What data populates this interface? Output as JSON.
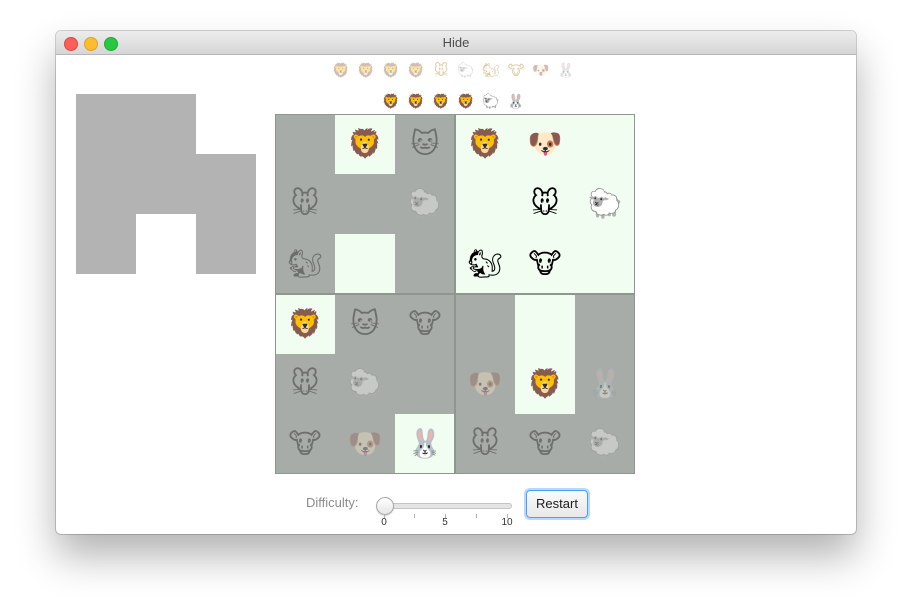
{
  "window": {
    "title": "Hide"
  },
  "colors": {
    "board_background": "#a8aca8",
    "revealed_cell": "#f1fdf0",
    "shape_block": "#b3b3b3",
    "focus_ring": "#4aa0f7"
  },
  "animal_icons": {
    "lion": "🦁",
    "cat": "🐱",
    "mouse": "🐭",
    "sheep": "🐑",
    "squirrel": "🐿",
    "dog": "🐶",
    "cow": "🐮",
    "rabbit": "🐰"
  },
  "queue_remaining": [
    "lion",
    "lion",
    "lion",
    "lion",
    "mouse",
    "sheep",
    "squirrel",
    "cow",
    "dog",
    "rabbit"
  ],
  "queue_active": [
    "lion",
    "lion",
    "lion",
    "lion",
    "sheep",
    "rabbit"
  ],
  "shape": [
    [
      true,
      true,
      false
    ],
    [
      true,
      true,
      true
    ],
    [
      true,
      false,
      true
    ]
  ],
  "board": {
    "cells": [
      [
        {
          "animal": "",
          "lit": false
        },
        {
          "animal": "lion",
          "lit": true
        },
        {
          "animal": "cat",
          "lit": false
        },
        {
          "animal": "lion",
          "lit": true
        },
        {
          "animal": "dog",
          "lit": true
        },
        {
          "animal": "",
          "lit": true
        }
      ],
      [
        {
          "animal": "mouse",
          "lit": false
        },
        {
          "animal": "",
          "lit": false
        },
        {
          "animal": "sheep",
          "lit": false
        },
        {
          "animal": "",
          "lit": true
        },
        {
          "animal": "mouse",
          "lit": true
        },
        {
          "animal": "sheep",
          "lit": true
        }
      ],
      [
        {
          "animal": "squirrel",
          "lit": false
        },
        {
          "animal": "",
          "lit": true
        },
        {
          "animal": "",
          "lit": false
        },
        {
          "animal": "squirrel",
          "lit": true
        },
        {
          "animal": "cow",
          "lit": true
        },
        {
          "animal": "",
          "lit": true
        }
      ],
      [
        {
          "animal": "lion",
          "lit": true
        },
        {
          "animal": "cat",
          "lit": false
        },
        {
          "animal": "cow",
          "lit": false
        },
        {
          "animal": "",
          "lit": false
        },
        {
          "animal": "",
          "lit": true
        },
        {
          "animal": "",
          "lit": false
        }
      ],
      [
        {
          "animal": "mouse",
          "lit": false
        },
        {
          "animal": "sheep",
          "lit": false
        },
        {
          "animal": "",
          "lit": false
        },
        {
          "animal": "dog",
          "lit": false
        },
        {
          "animal": "lion",
          "lit": true
        },
        {
          "animal": "rabbit",
          "lit": false
        }
      ],
      [
        {
          "animal": "cow",
          "lit": false
        },
        {
          "animal": "dog",
          "lit": false
        },
        {
          "animal": "rabbit",
          "lit": true
        },
        {
          "animal": "mouse",
          "lit": false
        },
        {
          "animal": "cow",
          "lit": false
        },
        {
          "animal": "sheep",
          "lit": false
        }
      ]
    ]
  },
  "controls": {
    "difficulty_label": "Difficulty:",
    "difficulty_value": 0,
    "difficulty_min": 0,
    "difficulty_max": 10,
    "tick_labels": [
      "0",
      "5",
      "10"
    ],
    "restart_label": "Restart"
  }
}
